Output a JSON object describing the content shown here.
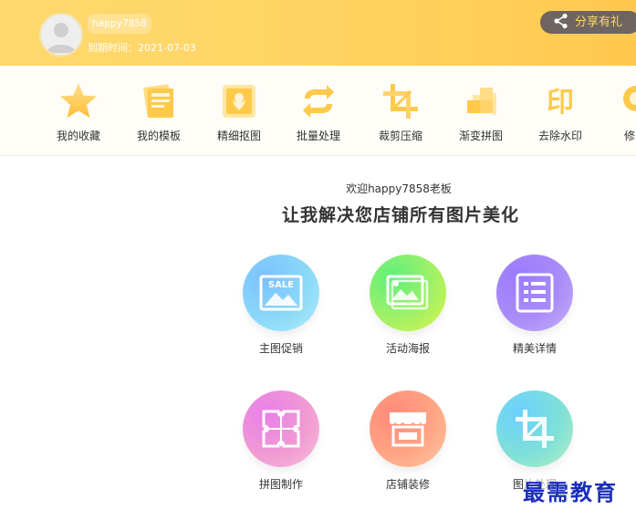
{
  "header": {
    "username": "happy7858",
    "expiry": "到期时间：2021-07-03",
    "share_label": "分享有礼"
  },
  "tools": [
    {
      "label": "我的收藏",
      "icon": "star-icon"
    },
    {
      "label": "我的模板",
      "icon": "template-icon"
    },
    {
      "label": "精细抠图",
      "icon": "cutout-icon"
    },
    {
      "label": "批量处理",
      "icon": "batch-icon"
    },
    {
      "label": "裁剪压缩",
      "icon": "crop-icon"
    },
    {
      "label": "渐变拼图",
      "icon": "puzzle-icon"
    },
    {
      "label": "去除水印",
      "icon": "watermark-icon"
    },
    {
      "label": "修图",
      "icon": "retouch-icon"
    }
  ],
  "main": {
    "welcome": "欢迎happy7858老板",
    "slogan": "让我解决您店铺所有图片美化"
  },
  "features": [
    {
      "label": "主图促销",
      "icon": "sale-image-icon",
      "badge": "SALE"
    },
    {
      "label": "活动海报",
      "icon": "poster-icon"
    },
    {
      "label": "精美详情",
      "icon": "detail-list-icon"
    },
    {
      "label": "拼图制作",
      "icon": "jigsaw-icon"
    },
    {
      "label": "店铺装修",
      "icon": "storefront-icon"
    },
    {
      "label": "图片处理",
      "icon": "image-crop-icon"
    }
  ],
  "watermark": "最需教育",
  "colors": {
    "header_bg": "#ffd463",
    "tool_icon": "#ffc94a",
    "share_bg": "#6e6462",
    "share_text": "#ffd866",
    "watermark": "#1b2fb8"
  }
}
